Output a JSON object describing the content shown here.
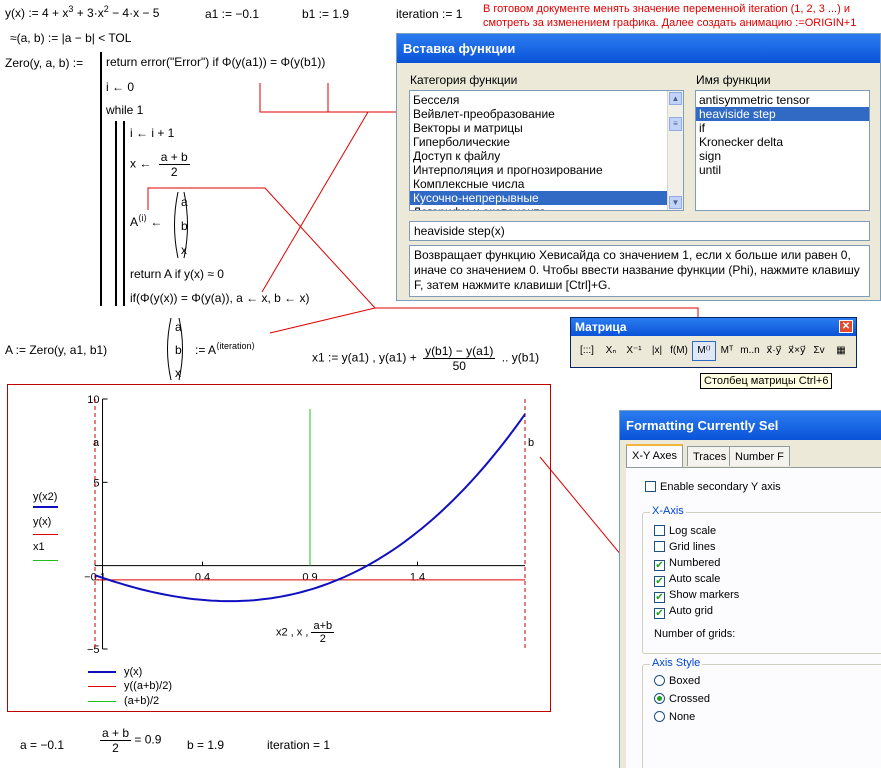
{
  "worksheet": {
    "def_y": "y(x) := 4 + x",
    "def_y_p3": "3",
    "def_y_mid": " + 3·x",
    "def_y_p2": "2",
    "def_y_end": " − 4·x − 5",
    "def_a1": "a1 := −0.1",
    "def_b1": "b1 := 1.9",
    "def_iter": "iteration := 1",
    "note": "В готовом документе менять значение переменной iteration (1, 2, 3 ...) и смотреть за изменением графика. Далее создать анимацию :=ORIGIN+1",
    "approx_def": "≈(a, b) := |a − b| < TOL",
    "zero_head": "Zero(y, a, b) :=",
    "prog_return": "return  error(\"Error\")   if   Φ(y(a1)) = Φ(y(b1))",
    "prog_i0": "i ← 0",
    "prog_while": "while   1",
    "prog_inc": "i ← i + 1",
    "prog_x": "x ←",
    "frac_ab_num": "a + b",
    "frac_ab_den": "2",
    "prog_A": "A",
    "prog_A_sup": "⟨i⟩",
    "prog_arrow": "←",
    "vec_a": "a",
    "vec_b": "b",
    "vec_x": "x",
    "prog_retA": "return  A   if   y(x) ≈ 0",
    "prog_if": "if(Φ(y(x)) = Φ(y(a)), a ← x, b ← x)",
    "A_def": "A := Zero(y, a1, b1)",
    "A_assign": ":= A",
    "A_sup": "⟨iteration⟩",
    "x1_def": "x1 := y(a1) , y(a1) +",
    "x1_num": "y(b1) − y(a1)",
    "x1_den": "50",
    "x1_end": ".. y(b1)",
    "res_a": "a = −0.1",
    "res_mid": "= 0.9",
    "res_b": "b = 1.9",
    "res_iter": "iteration = 1"
  },
  "insert_function_dialog": {
    "title": "Вставка функции",
    "category_label": "Категория функции",
    "name_label": "Имя функции",
    "categories": [
      "Бесселя",
      "Вейвлет-преобразование",
      "Векторы и матрицы",
      "Гиперболические",
      "Доступ к файлу",
      "Интерполяция и прогнозирование",
      "Комплексные числа",
      "Кусочно-непрерывные",
      "Логарифм и экспонента"
    ],
    "selected_category": "Кусочно-непрерывные",
    "functions": [
      "antisymmetric tensor",
      "heaviside step",
      "if",
      "Kronecker delta",
      "sign",
      "until"
    ],
    "selected_function": "heaviside step",
    "signature": "heaviside step(x)",
    "description": "Возвращает функцию Хевисайда со значением 1, если x больше или равен 0, иначе со значением 0. Чтобы ввести название функции (Phi), нажмите клавишу F, затем нажмите клавиши [Ctrl]+G."
  },
  "matrix_toolbar": {
    "title": "Матрица",
    "buttons": [
      "[:::]",
      "Xₙ",
      "X⁻¹",
      "|x|",
      "f(M)",
      "M⁽⁾",
      "Mᵀ",
      "m..n",
      "x⃗·y⃗",
      "x⃗×y⃗",
      "Σv",
      "▦"
    ],
    "tooltip": "Столбец матрицы Ctrl+6"
  },
  "formatting_dialog": {
    "title": "Formatting Currently Sel",
    "tabs": [
      "X-Y Axes",
      "Traces",
      "Number F"
    ],
    "active_tab": "X-Y Axes",
    "secondary_y": {
      "label": "Enable secondary Y axis",
      "checked": false
    },
    "xaxis_group": "X-Axis",
    "options": [
      {
        "label": "Log scale",
        "checked": false
      },
      {
        "label": "Grid lines",
        "checked": false
      },
      {
        "label": "Numbered",
        "checked": true
      },
      {
        "label": "Auto scale",
        "checked": true
      },
      {
        "label": "Show markers",
        "checked": true
      },
      {
        "label": "Auto grid",
        "checked": true
      }
    ],
    "grids_label": "Number of grids:",
    "axis_style_group": "Axis Style",
    "axis_styles": [
      {
        "label": "Boxed",
        "selected": false
      },
      {
        "label": "Crossed",
        "selected": true
      },
      {
        "label": "None",
        "selected": false
      }
    ]
  },
  "plot": {
    "marker_a": "a",
    "marker_b": "b",
    "y_legend": [
      "y(x2)",
      "y(x)",
      "x1"
    ],
    "x_axis_expr": "x2 , x ,",
    "x_axis_frac_num": "a+b",
    "x_axis_frac_den": "2",
    "legend": [
      "y(x)",
      "y((a+b)/2)",
      "(a+b)/2"
    ],
    "x_tick_labels": [
      "−0.1",
      "0.4",
      "0.9",
      "1.4"
    ],
    "y_tick_labels": [
      "10",
      "5",
      "−5"
    ],
    "colors": {
      "curve": "#1010c0",
      "hline": "#e00000",
      "vline": "#20c020"
    }
  },
  "chart_data": {
    "type": "line",
    "xlim": [
      -0.1,
      1.9
    ],
    "ylim": [
      -5,
      10
    ],
    "a": -0.1,
    "b": 1.9,
    "mid": 0.9,
    "hline_y": -0.851,
    "x_ticks": [
      -0.1,
      0.4,
      0.9,
      1.4
    ],
    "y_ticks": [
      10,
      5,
      -5
    ],
    "series": [
      {
        "name": "y(x)",
        "function": "4 + x^3 + 3x^2 - 4x - 5"
      },
      {
        "name": "y((a+b)/2)",
        "value": -0.851
      },
      {
        "name": "(a+b)/2",
        "value": 0.9
      }
    ]
  }
}
